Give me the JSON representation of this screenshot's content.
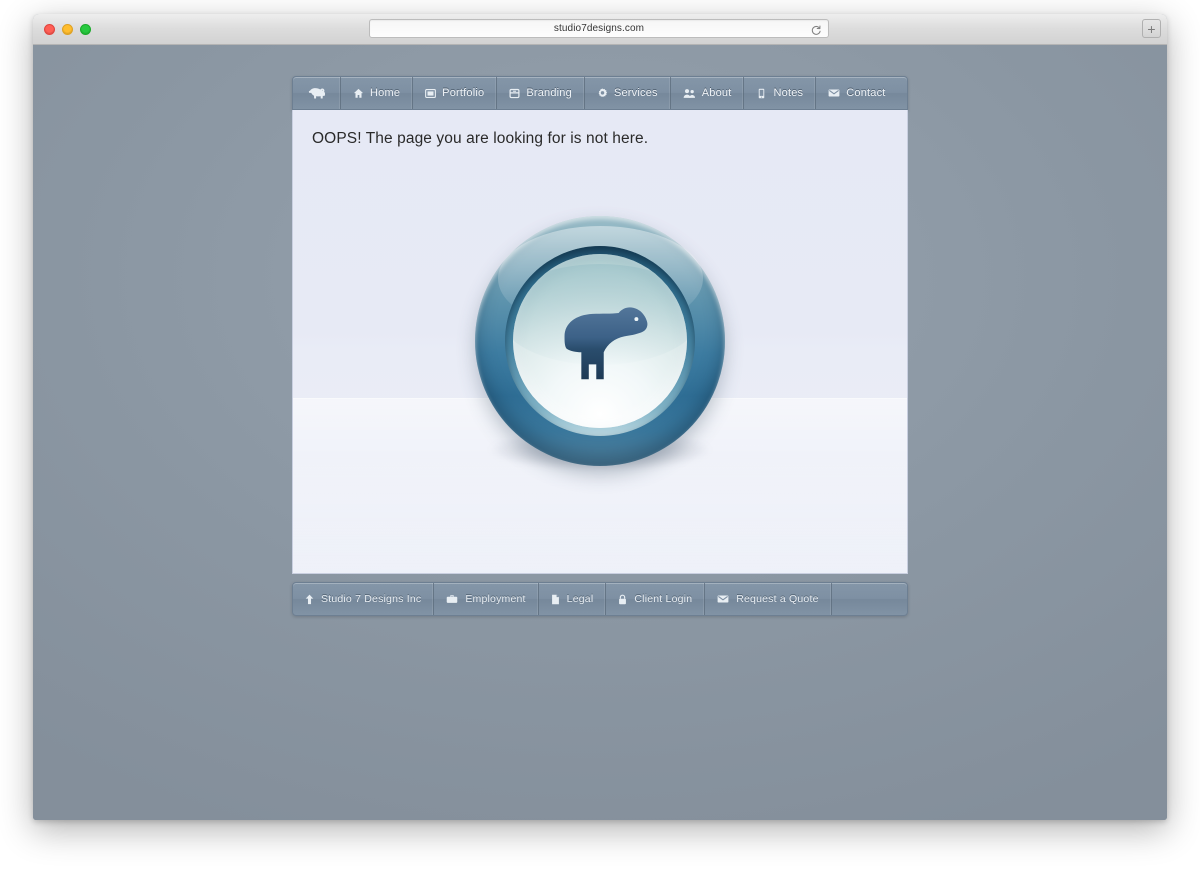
{
  "browser": {
    "url": "studio7designs.com",
    "reload_icon": "reload-icon",
    "new_tab_label": "+",
    "traffic_lights": [
      "close",
      "minimize",
      "maximize"
    ]
  },
  "site": {
    "nav": {
      "logo_icon": "bear-logo-icon",
      "items": [
        {
          "label": "Home",
          "icon": "home-icon"
        },
        {
          "label": "Portfolio",
          "icon": "image-frame-icon"
        },
        {
          "label": "Branding",
          "icon": "box-icon"
        },
        {
          "label": "Services",
          "icon": "gear-icon"
        },
        {
          "label": "About",
          "icon": "people-icon"
        },
        {
          "label": "Notes",
          "icon": "notepad-icon"
        },
        {
          "label": "Contact",
          "icon": "envelope-icon"
        }
      ]
    },
    "content": {
      "message": "OOPS! The page you are looking for is not here.",
      "badge_icon": "bear-badge-icon"
    },
    "footer": {
      "items": [
        {
          "label": "Studio 7 Designs Inc",
          "icon": "arrow-up-icon"
        },
        {
          "label": "Employment",
          "icon": "briefcase-icon"
        },
        {
          "label": "Legal",
          "icon": "document-icon"
        },
        {
          "label": "Client Login",
          "icon": "lock-icon"
        },
        {
          "label": "Request a Quote",
          "icon": "envelope-icon"
        }
      ]
    }
  },
  "colors": {
    "nav_blue": "#7e90a3",
    "badge_ring": "#3d7ca1",
    "bear_body": "#2d5574",
    "content_bg": "#e8ebf5",
    "desktop_bg": "#8b97a3"
  }
}
